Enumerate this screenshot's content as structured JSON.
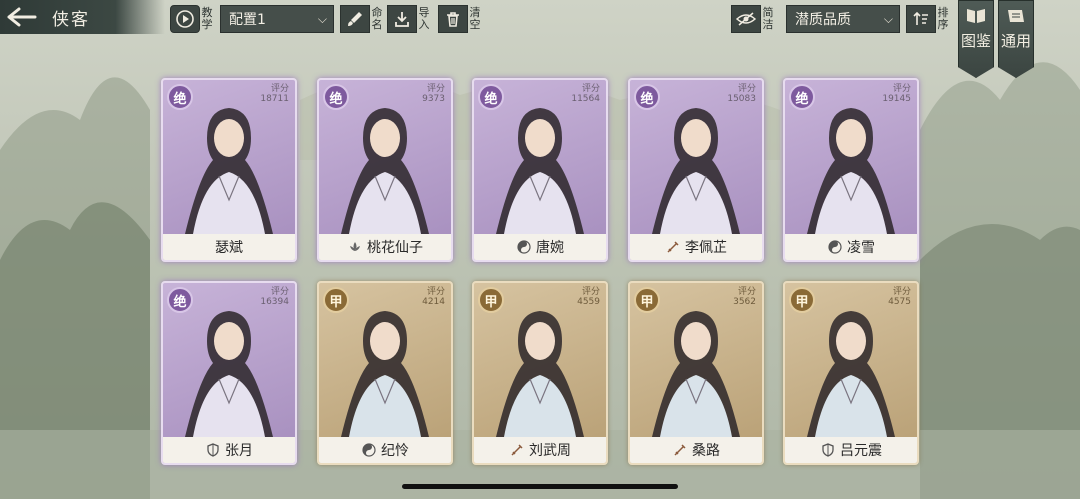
{
  "header": {
    "title": "侠客",
    "tutorial_label": "教学",
    "config_select": "配置1",
    "rename_label": "命名",
    "import_label": "导入",
    "clear_label": "清空",
    "simple_label": "简洁",
    "sort_select": "潜质品质",
    "sort_label": "排序",
    "atlas_label": "图鉴",
    "general_label": "通用"
  },
  "colors": {
    "purple_tier": "#a58dbd",
    "gold_tier": "#b79e73",
    "toolbar": "#454e4a"
  },
  "cards": [
    {
      "name": "瑟斌",
      "rank": "绝",
      "score_label": "评分",
      "score": "18711",
      "faction_icon": "none",
      "tier": "purple"
    },
    {
      "name": "桃花仙子",
      "rank": "绝",
      "score_label": "评分",
      "score": "9373",
      "faction_icon": "lotus-icon",
      "tier": "purple"
    },
    {
      "name": "唐婉",
      "rank": "绝",
      "score_label": "评分",
      "score": "11564",
      "faction_icon": "taiji-icon",
      "tier": "purple"
    },
    {
      "name": "李佩芷",
      "rank": "绝",
      "score_label": "评分",
      "score": "15083",
      "faction_icon": "sword-icon",
      "tier": "purple"
    },
    {
      "name": "凌雪",
      "rank": "绝",
      "score_label": "评分",
      "score": "19145",
      "faction_icon": "taiji-icon",
      "tier": "purple"
    },
    {
      "name": "张月",
      "rank": "绝",
      "score_label": "评分",
      "score": "16394",
      "faction_icon": "shield-icon",
      "tier": "purple"
    },
    {
      "name": "纪怜",
      "rank": "甲",
      "score_label": "评分",
      "score": "4214",
      "faction_icon": "taiji-icon",
      "tier": "gold"
    },
    {
      "name": "刘武周",
      "rank": "甲",
      "score_label": "评分",
      "score": "4559",
      "faction_icon": "sword-icon",
      "tier": "gold"
    },
    {
      "name": "桑路",
      "rank": "甲",
      "score_label": "评分",
      "score": "3562",
      "faction_icon": "sword-icon",
      "tier": "gold"
    },
    {
      "name": "吕元震",
      "rank": "甲",
      "score_label": "评分",
      "score": "4575",
      "faction_icon": "shield-icon",
      "tier": "gold"
    }
  ]
}
